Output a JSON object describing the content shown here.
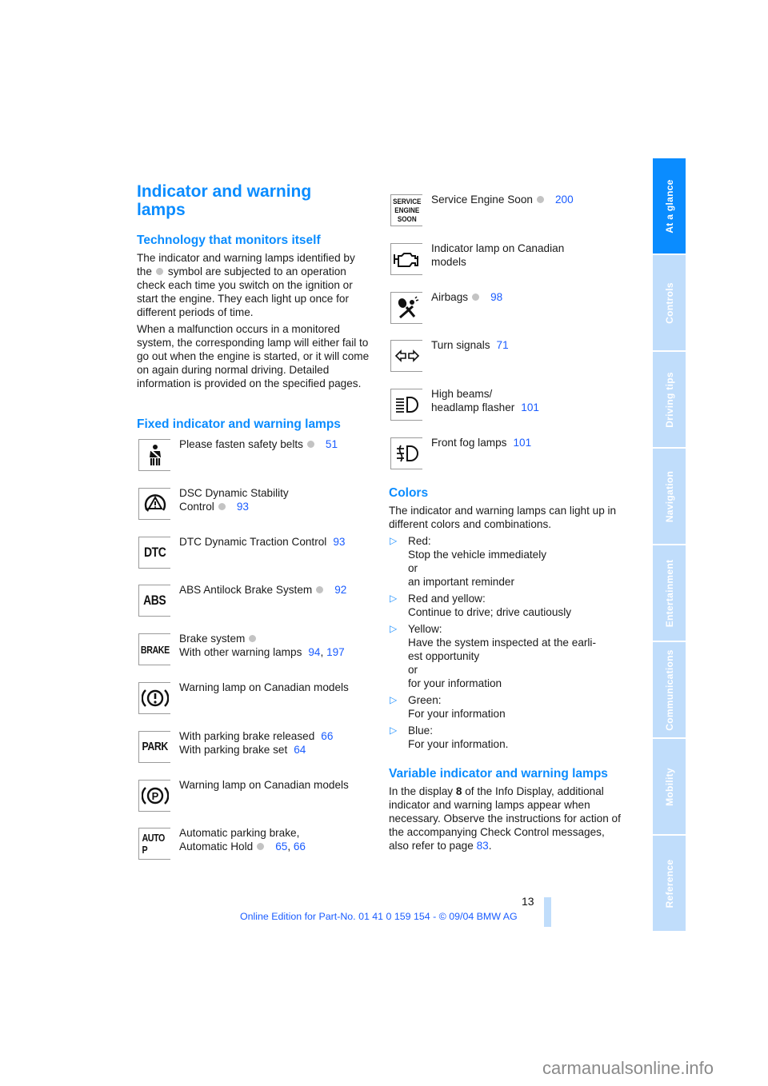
{
  "page": {
    "title": "Indicator and warning lamps",
    "page_number": "13",
    "footer": "Online Edition for Part-No. 01 41 0 159 154 - © 09/04 BMW AG",
    "watermark": "carmanualsonline.info"
  },
  "intro": {
    "heading": "Technology that monitors itself",
    "para1_before": "The indicator and warning lamps identified by the",
    "para1_after": "symbol are subjected to an operation check each time you switch on the ignition or start the engine. They each light up once for different periods of time.",
    "para2": "When a malfunction occurs in a monitored system, the corresponding lamp will either fail to go out when the engine is started, or it will come on again during normal driving. Detailed information is provided on the specified pages."
  },
  "fixed": {
    "heading": "Fixed indicator and warning lamps",
    "lamps": [
      {
        "icon": "seatbelt-icon",
        "line1": "Please fasten safety belts",
        "dot": true,
        "refs": [
          "51"
        ]
      },
      {
        "icon": "dsc-icon",
        "line1": "DSC Dynamic Stability",
        "line2": "Control",
        "dot": true,
        "refs": [
          "93"
        ]
      },
      {
        "icon": "dtc-icon",
        "icon_text": "DTC",
        "line1": "DTC Dynamic Traction Control",
        "refs": [
          "93"
        ]
      },
      {
        "icon": "abs-icon",
        "icon_text": "ABS",
        "line1": "ABS Antilock Brake System",
        "dot": true,
        "refs": [
          "92"
        ]
      },
      {
        "icon": "brake-icon",
        "icon_text": "BRAKE",
        "line1": "Brake system",
        "line1_dot": true,
        "line2": "With other warning lamps",
        "refs": [
          "94",
          "197"
        ]
      },
      {
        "icon": "brake-warning-canada-icon",
        "line1": "Warning lamp on Canadian models"
      },
      {
        "icon": "park-icon",
        "icon_text": "PARK",
        "line1": "With parking brake released",
        "line1_refs": [
          "66"
        ],
        "line2": "With parking brake set",
        "refs": [
          "64"
        ]
      },
      {
        "icon": "parking-brake-canada-icon",
        "line1": "Warning lamp on Canadian models"
      },
      {
        "icon": "auto-p-icon",
        "icon_text": "AUTO P",
        "line1": "Automatic parking brake,",
        "line2": "Automatic Hold",
        "dot": true,
        "refs": [
          "65",
          "66"
        ]
      }
    ]
  },
  "right_lamps": [
    {
      "icon": "service-engine-soon-icon",
      "icon_text": [
        "SERVICE",
        "ENGINE",
        "SOON"
      ],
      "line1": "Service Engine Soon",
      "dot": true,
      "refs": [
        "200"
      ]
    },
    {
      "icon": "engine-icon",
      "line1": "Indicator lamp on Canadian",
      "line2": "models"
    },
    {
      "icon": "airbag-icon",
      "line1": "Airbags",
      "dot": true,
      "refs": [
        "98"
      ]
    },
    {
      "icon": "turn-signals-icon",
      "line1": "Turn signals",
      "refs": [
        "71"
      ]
    },
    {
      "icon": "high-beam-icon",
      "line1": "High beams/",
      "line2": "headlamp flasher",
      "refs": [
        "101"
      ]
    },
    {
      "icon": "fog-lamp-icon",
      "line1": "Front fog lamps",
      "refs": [
        "101"
      ]
    }
  ],
  "colors": {
    "heading": "Colors",
    "intro": "The indicator and warning lamps can light up in different colors and combinations.",
    "items": [
      {
        "lines": [
          "Red:",
          "Stop the vehicle immediately",
          "or",
          "an important reminder"
        ]
      },
      {
        "lines": [
          "Red and yellow:",
          "Continue to drive; drive cautiously"
        ]
      },
      {
        "lines": [
          "Yellow:",
          "Have the system inspected at the earli-",
          "est opportunity",
          "or",
          "for your information"
        ]
      },
      {
        "lines": [
          "Green:",
          "For your information"
        ]
      },
      {
        "lines": [
          "Blue:",
          "For your information."
        ]
      }
    ]
  },
  "variable": {
    "heading": "Variable indicator and warning lamps",
    "text_before": "In the display",
    "display_number": "8",
    "text_after": "of the Info Display, additional indicator and warning lamps appear when necessary. Observe the instructions for action of the accompanying Check Control messages, also refer to page",
    "ref": "83",
    "end": "."
  },
  "side_tabs": [
    {
      "label": "At a glance",
      "active": true
    },
    {
      "label": "Controls"
    },
    {
      "label": "Driving tips"
    },
    {
      "label": "Navigation"
    },
    {
      "label": "Entertainment"
    },
    {
      "label": "Communications"
    },
    {
      "label": "Mobility"
    },
    {
      "label": "Reference"
    }
  ],
  "colors_palette": {
    "heading_blue": "#0a8cff",
    "link_blue": "#1a5cff",
    "tab_active": "#0a8cff",
    "tab_inactive": "#c0ddfb",
    "status_dot": "#c3c3c3"
  }
}
